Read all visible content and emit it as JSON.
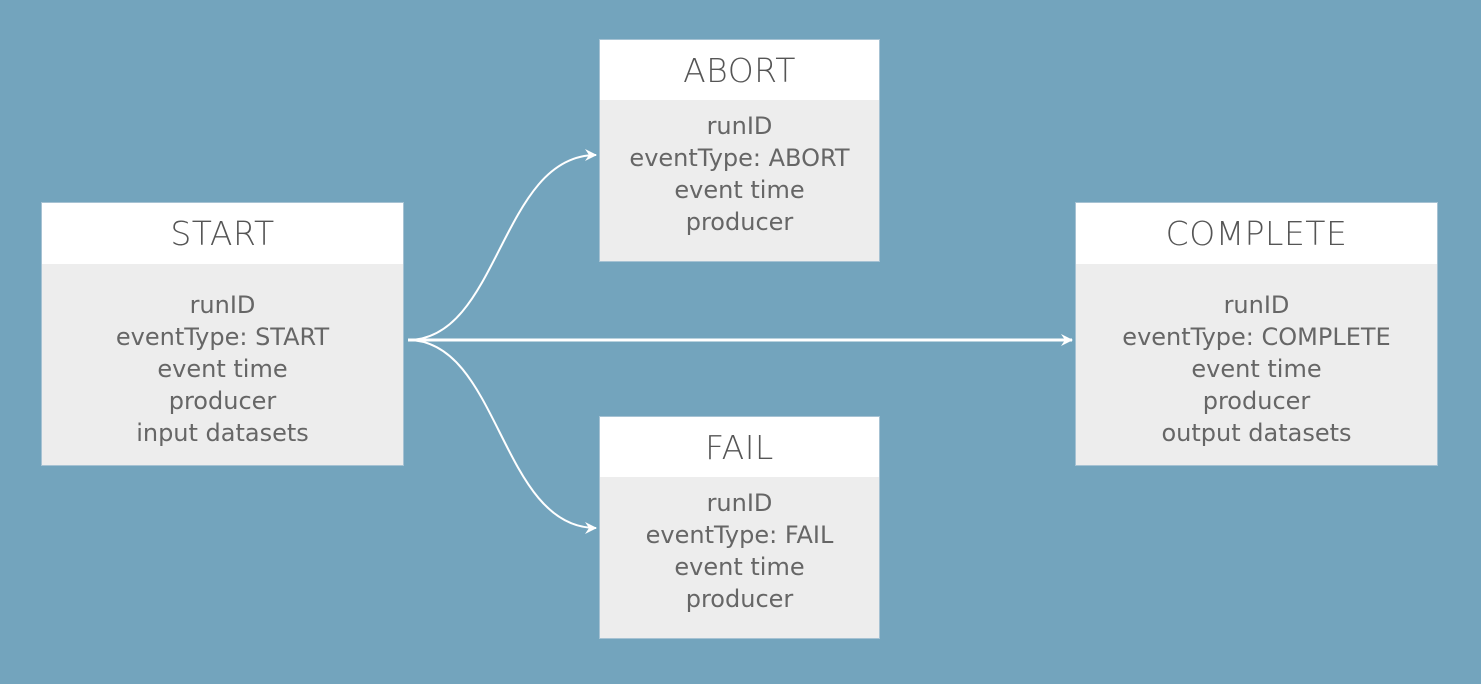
{
  "colors": {
    "background": "#73a4bd",
    "header": "#ffffff",
    "body": "#ededed",
    "edge": "#ffffff",
    "text": "#555555"
  },
  "nodes": {
    "start": {
      "title": "START",
      "fields": [
        "runID",
        "eventType: START",
        "event time",
        "producer",
        "input datasets"
      ]
    },
    "abort": {
      "title": "ABORT",
      "fields": [
        "runID",
        "eventType: ABORT",
        "event time",
        "producer"
      ]
    },
    "fail": {
      "title": "FAIL",
      "fields": [
        "runID",
        "eventType: FAIL",
        "event time",
        "producer"
      ]
    },
    "complete": {
      "title": "COMPLETE",
      "fields": [
        "runID",
        "eventType: COMPLETE",
        "event time",
        "producer",
        "output datasets"
      ]
    }
  },
  "edges": [
    {
      "from": "START",
      "to": "ABORT"
    },
    {
      "from": "START",
      "to": "COMPLETE"
    },
    {
      "from": "START",
      "to": "FAIL"
    }
  ]
}
